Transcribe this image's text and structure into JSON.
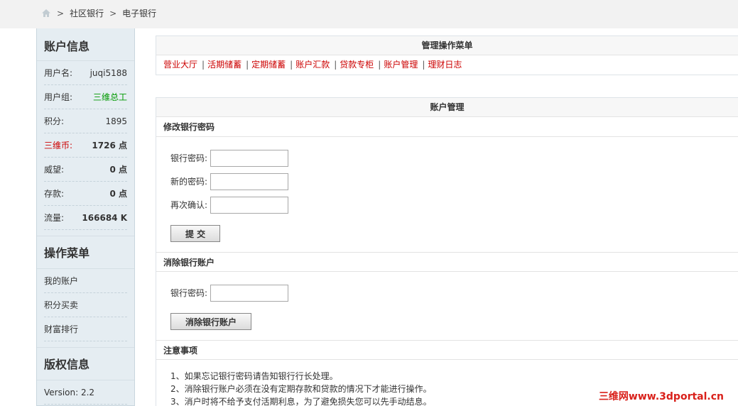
{
  "breadcrumb": {
    "items": [
      "社区银行",
      "电子银行"
    ],
    "separator": ">"
  },
  "sidebar": {
    "account_title": "账户信息",
    "account_rows": [
      {
        "label": "用户名:",
        "value": "juqi5188"
      },
      {
        "label": "用户组:",
        "value": "三维总工"
      },
      {
        "label": "积分:",
        "value": "1895"
      },
      {
        "label": "三维币:",
        "value": "1726 点"
      },
      {
        "label": "威望:",
        "value": "0 点"
      },
      {
        "label": "存款:",
        "value": "0 点"
      },
      {
        "label": "流量:",
        "value": "166684 K"
      }
    ],
    "menu_title": "操作菜单",
    "menu_items": [
      "我的账户",
      "积分买卖",
      "财富排行"
    ],
    "copyright_title": "版权信息",
    "version": "Version: 2.2"
  },
  "top_menu": {
    "title": "管理操作菜单",
    "links": [
      "营业大厅",
      "活期储蓄",
      "定期储蓄",
      "账户汇款",
      "贷款专柜",
      "账户管理",
      "理财日志"
    ]
  },
  "account_mgmt": {
    "title": "账户管理",
    "change_pwd": {
      "title": "修改银行密码",
      "fields": [
        "银行密码:",
        "新的密码:",
        "再次确认:"
      ],
      "submit": "提 交"
    },
    "delete_account": {
      "title": "消除银行账户",
      "field": "银行密码:",
      "button": "消除银行账户"
    },
    "notes": {
      "title": "注意事项",
      "items": [
        "1、如果忘记银行密码请告知银行行长处理。",
        "2、消除银行账户必须在没有定期存款和贷款的情况下才能进行操作。",
        "3、消户时将不给予支付活期利息，为了避免损失您可以先手动结息。"
      ]
    }
  },
  "watermark": "三维网www.3dportal.cn",
  "colors": {
    "link": "#cc0000",
    "group": "#009900",
    "currency_label": "#cc0000",
    "sidebar_bg": "#e5edf2"
  }
}
